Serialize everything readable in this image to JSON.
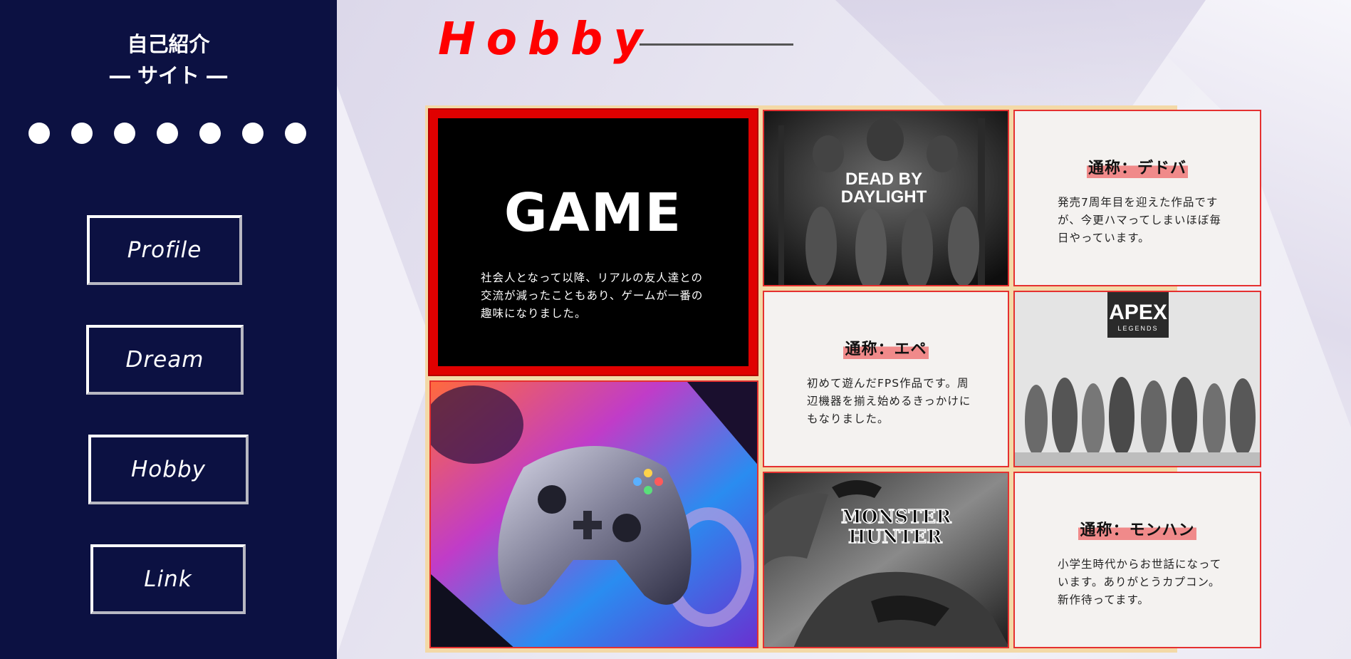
{
  "sidebar": {
    "title_line1": "自己紹介",
    "title_line2": "― サイト ―",
    "dot_count": 7,
    "nav": [
      {
        "label": "Profile"
      },
      {
        "label": "Dream"
      },
      {
        "label": "Hobby"
      },
      {
        "label": "Link"
      }
    ]
  },
  "main": {
    "title": "Hobby",
    "game_card": {
      "heading": "GAME",
      "description": "社会人となって以降、リアルの友人達との交流が減ったこともあり、ゲームが一番の趣味になりました。"
    },
    "games": [
      {
        "logo_line1": "DEAD BY",
        "logo_line2": "DAYLIGHT",
        "nickname": "通称：デドバ",
        "description": "発売7周年目を迎えた作品ですが、今更ハマってしまいほぼ毎日やっています。"
      },
      {
        "logo_line1": "APEX",
        "logo_line2": "LEGENDS",
        "nickname": "通称：エペ",
        "description": "初めて遊んだFPS作品です。周辺機器を揃え始めるきっかけにもなりました。"
      },
      {
        "logo_line1": "MONSTER",
        "logo_line2": "HUNTER",
        "nickname": "通称：モンハン",
        "description": "小学生時代からお世話になっています。ありがとうカプコン。新作待ってます。"
      }
    ]
  },
  "colors": {
    "sidebar_bg": "#0c1142",
    "accent_red": "#ff0000",
    "grid_border": "#f3d9a7"
  }
}
